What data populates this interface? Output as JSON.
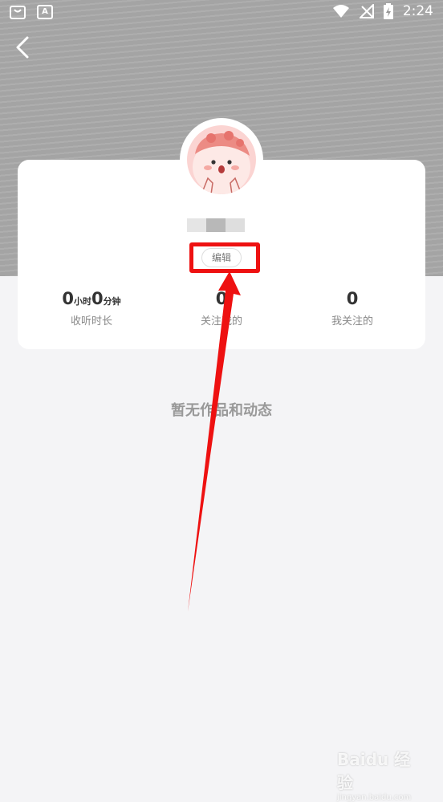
{
  "status_bar": {
    "time": "2:24",
    "left_icons": [
      "shopping-bag-icon",
      "a-app-icon"
    ],
    "right_icons": [
      "wifi-icon",
      "no-signal-icon",
      "battery-charging-icon"
    ]
  },
  "nav": {
    "back_icon": "chevron-left-icon"
  },
  "profile": {
    "edit_label": "编辑",
    "stats": [
      {
        "value_parts": [
          "0",
          "小时",
          "0",
          "分钟"
        ],
        "label": "收听时长"
      },
      {
        "value": "0",
        "label": "关注我的"
      },
      {
        "value": "0",
        "label": "我关注的"
      }
    ]
  },
  "content": {
    "empty_message": "暂无作品和动态"
  },
  "annotation": {
    "color": "#ee1111"
  },
  "watermark": {
    "text": "Baidu 经验",
    "sub": "jingyan.baidu.com"
  }
}
